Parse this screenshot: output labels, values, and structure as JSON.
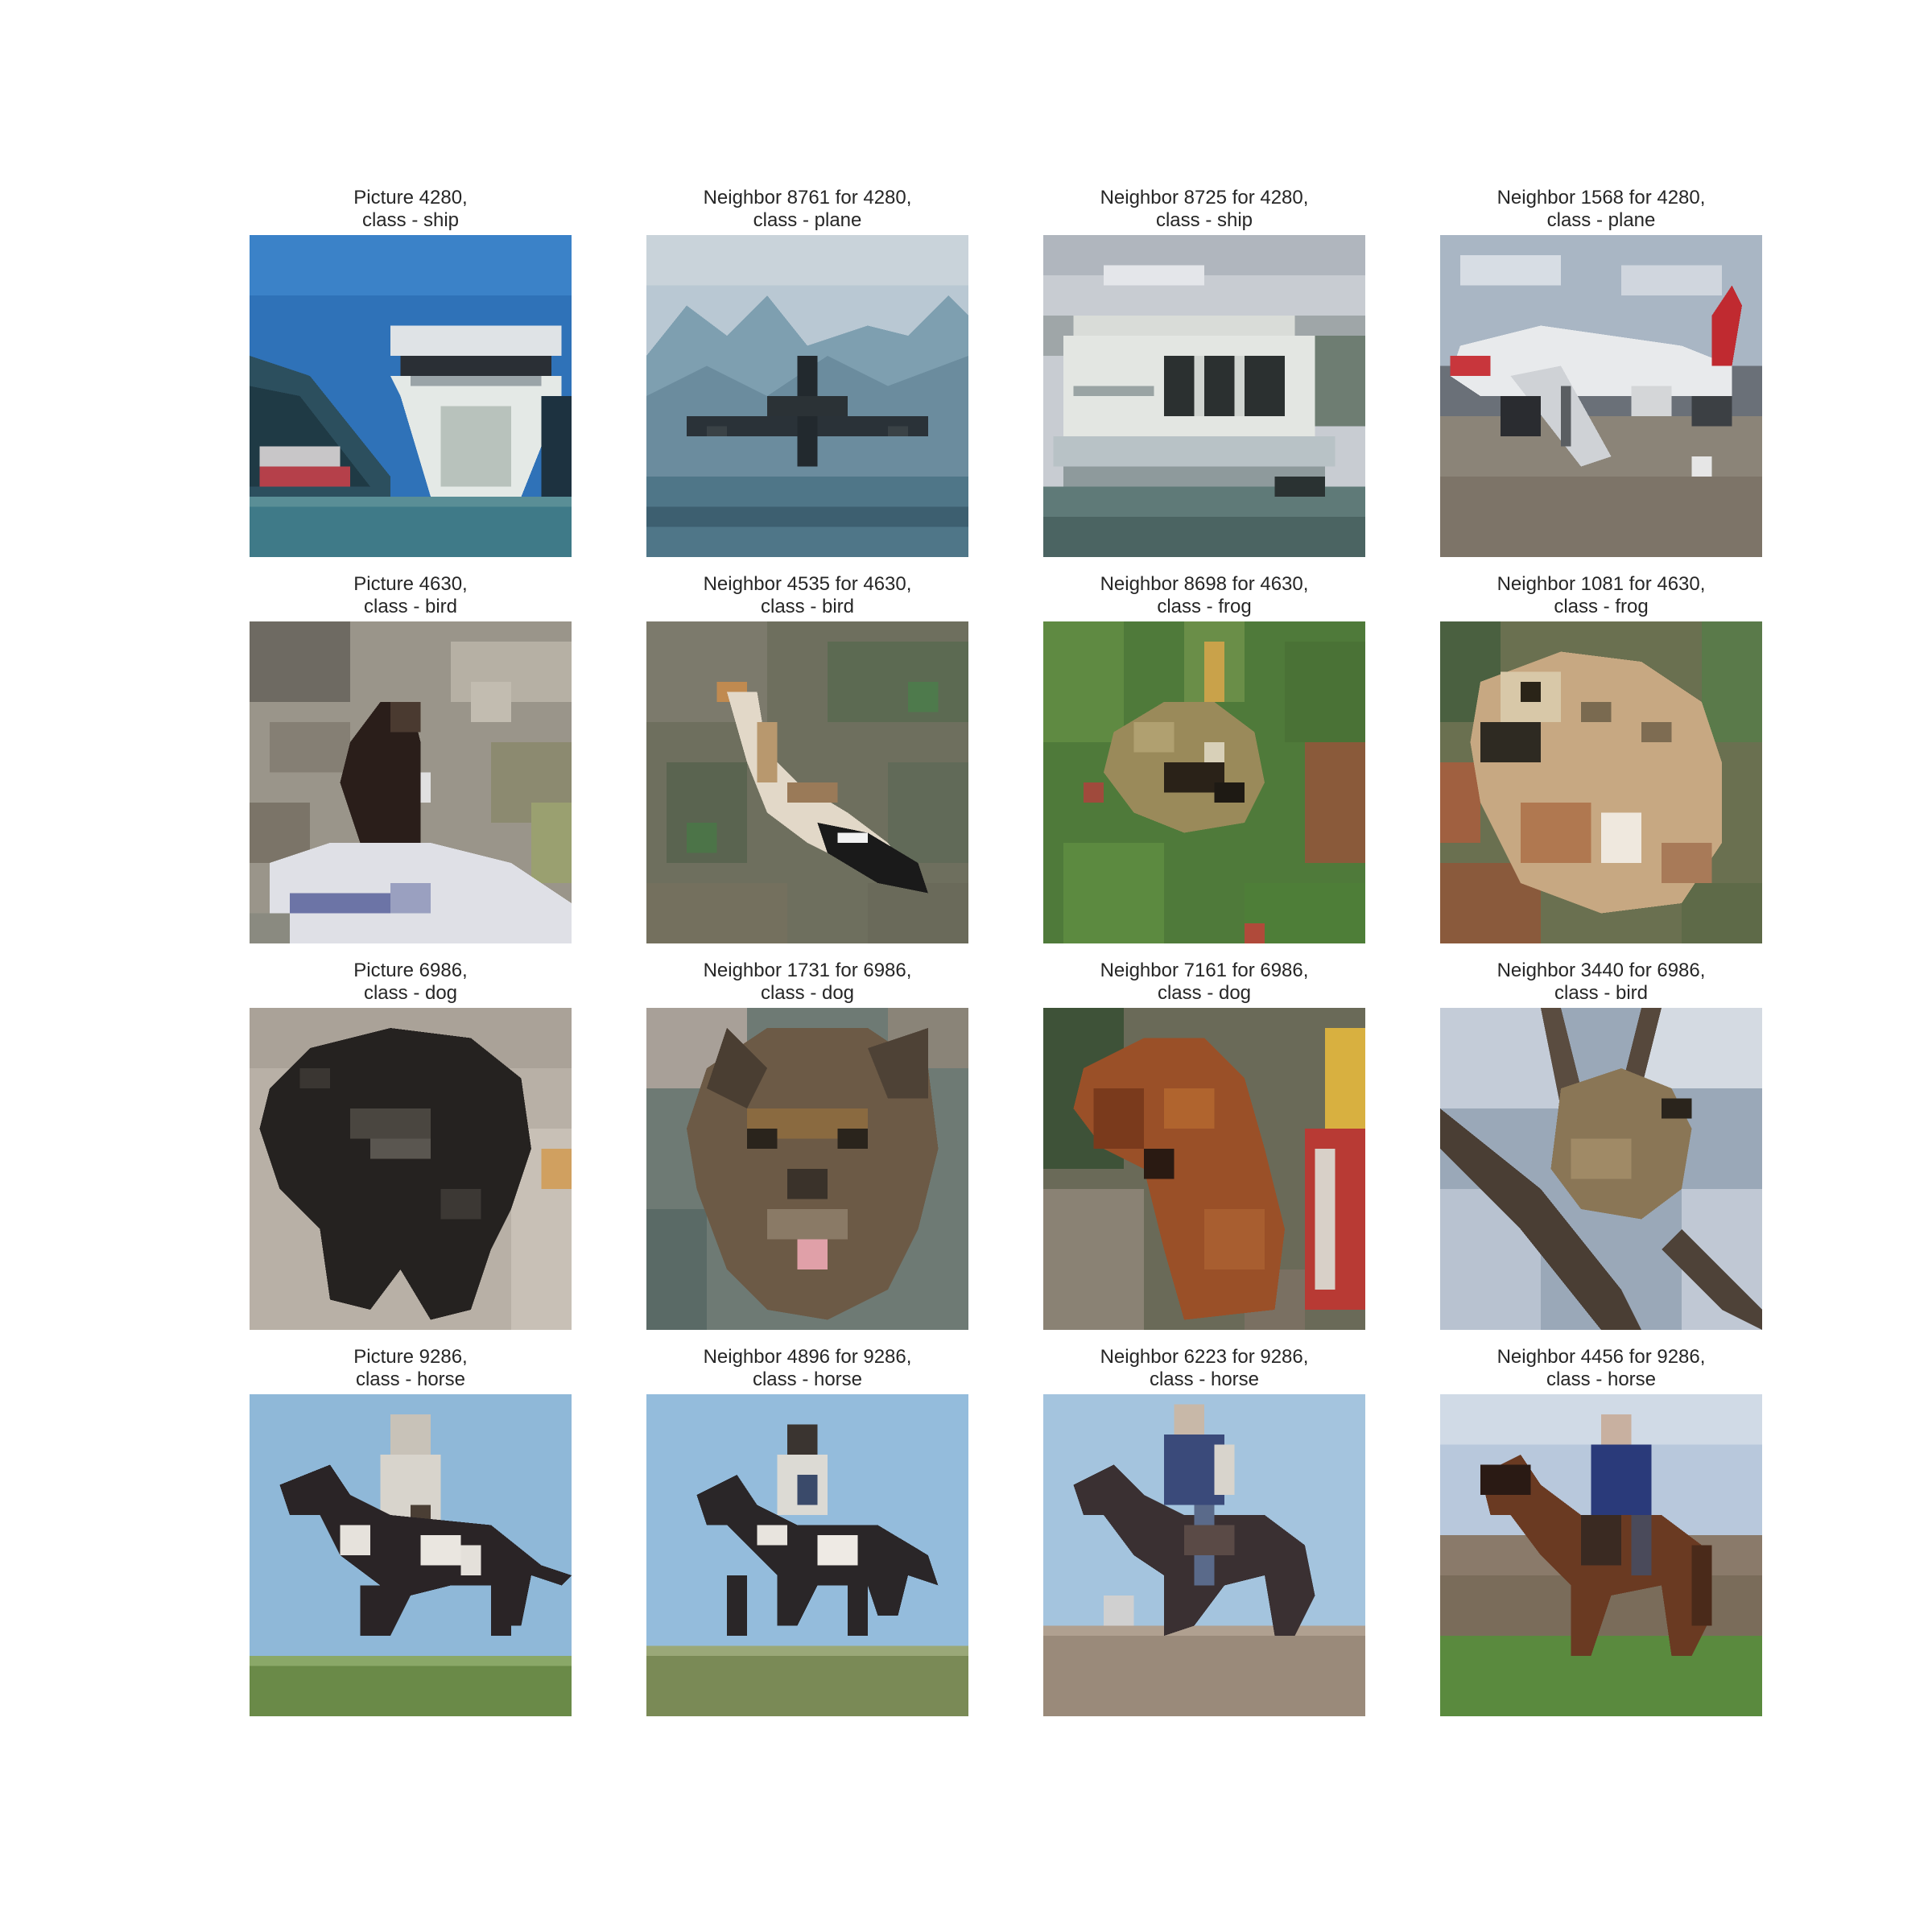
{
  "panels": [
    {
      "line1": "Picture 4280,",
      "line2": "class - ship",
      "scene": "ship"
    },
    {
      "line1": "Neighbor 8761 for 4280,",
      "line2": "class - plane",
      "scene": "plane-takeoff"
    },
    {
      "line1": "Neighbor 8725 for 4280,",
      "line2": "class - ship",
      "scene": "ferry"
    },
    {
      "line1": "Neighbor 1568 for 4280,",
      "line2": "class - plane",
      "scene": "plane-parked"
    },
    {
      "line1": "Picture 4630,",
      "line2": "class - bird",
      "scene": "bird-perched"
    },
    {
      "line1": "Neighbor 4535 for 4630,",
      "line2": "class - bird",
      "scene": "bird-ground"
    },
    {
      "line1": "Neighbor 8698 for 4630,",
      "line2": "class - frog",
      "scene": "frog-grass"
    },
    {
      "line1": "Neighbor 1081 for 4630,",
      "line2": "class - frog",
      "scene": "frog-closeup"
    },
    {
      "line1": "Picture 6986,",
      "line2": "class - dog",
      "scene": "dog-black"
    },
    {
      "line1": "Neighbor 1731 for 6986,",
      "line2": "class - dog",
      "scene": "dog-face"
    },
    {
      "line1": "Neighbor 7161 for 6986,",
      "line2": "class - dog",
      "scene": "dog-brown"
    },
    {
      "line1": "Neighbor 3440 for 6986,",
      "line2": "class - bird",
      "scene": "bird-branch"
    },
    {
      "line1": "Picture 9286,",
      "line2": "class - horse",
      "scene": "horse-rider"
    },
    {
      "line1": "Neighbor 4896 for 9286,",
      "line2": "class - horse",
      "scene": "horse-rider"
    },
    {
      "line1": "Neighbor 6223 for 9286,",
      "line2": "class - horse",
      "scene": "horse-rider-dark"
    },
    {
      "line1": "Neighbor 4456 for 9286,",
      "line2": "class - horse",
      "scene": "horse-rider-brown"
    }
  ]
}
